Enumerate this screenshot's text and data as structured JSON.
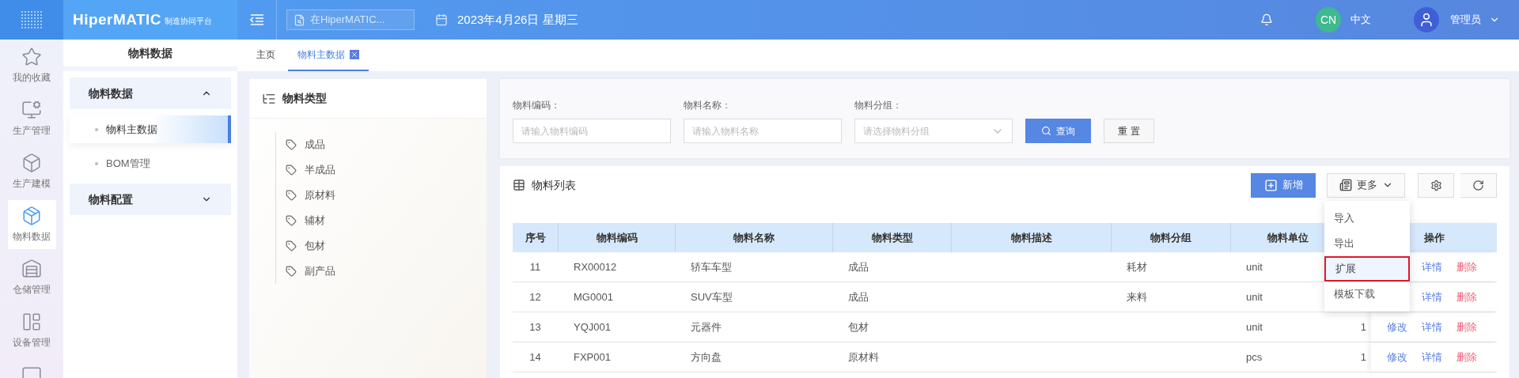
{
  "topbar": {
    "brand": "HiperMATIC",
    "brand_subtitle": "制造协同平台",
    "search": {
      "placeholder": "在HiperMATIC..."
    },
    "date": "2023年4月26日 星期三",
    "language_badge": "CN",
    "language": "中文",
    "user": "管理员"
  },
  "rail": [
    {
      "label": "我的收藏",
      "selected": false
    },
    {
      "label": "生产管理",
      "selected": false
    },
    {
      "label": "生产建模",
      "selected": false
    },
    {
      "label": "物料数据",
      "selected": true
    },
    {
      "label": "仓储管理",
      "selected": false
    },
    {
      "label": "设备管理",
      "selected": false
    }
  ],
  "menu": {
    "title": "物料数据",
    "groups": [
      {
        "label": "物料数据",
        "expanded": true,
        "children": [
          {
            "label": "物料主数据",
            "selected": true
          },
          {
            "label": "BOM管理",
            "selected": false
          }
        ]
      },
      {
        "label": "物料配置",
        "expanded": false
      }
    ]
  },
  "tabs": [
    {
      "label": "主页",
      "selected": false,
      "closable": false
    },
    {
      "label": "物料主数据",
      "selected": true,
      "closable": true
    }
  ],
  "types_panel": {
    "title": "物料类型",
    "items": [
      "成品",
      "半成品",
      "原材料",
      "辅材",
      "包材",
      "副产品"
    ]
  },
  "filters": {
    "fields": [
      {
        "label": "物料编码：",
        "placeholder": "请输入物料编码",
        "kind": "input"
      },
      {
        "label": "物料名称：",
        "placeholder": "请输入物料名称",
        "kind": "input"
      },
      {
        "label": "物料分组：",
        "placeholder": "请选择物料分组",
        "kind": "select"
      }
    ],
    "buttons": [
      {
        "label": "查询",
        "kind": "primary"
      },
      {
        "label": "重 置",
        "kind": "default"
      }
    ]
  },
  "list": {
    "title": "物料列表",
    "add_button": "新增",
    "more_button": "更多",
    "more_menu": [
      {
        "label": "导入",
        "highlighted": false
      },
      {
        "label": "导出",
        "highlighted": false
      },
      {
        "label": "扩展",
        "highlighted": true
      },
      {
        "label": "模板下载",
        "highlighted": false
      }
    ],
    "columns": [
      "序号",
      "物料编码",
      "物料名称",
      "物料类型",
      "物料描述",
      "物料分组",
      "物料单位",
      "操作"
    ],
    "rows": [
      {
        "no": "11",
        "code": "RX00012",
        "name": "轿车车型",
        "type": "成品",
        "group": "耗材",
        "unit": "unit",
        "actions": [
          {
            "kind": "detail",
            "label": "详情"
          },
          {
            "kind": "delete",
            "label": "删除"
          }
        ]
      },
      {
        "no": "12",
        "code": "MG0001",
        "name": "SUV车型",
        "type": "成品",
        "group": "来料",
        "unit": "unit",
        "actions": [
          {
            "kind": "detail",
            "label": "详情"
          },
          {
            "kind": "delete",
            "label": "删除"
          }
        ]
      },
      {
        "no": "13",
        "code": "YQJ001",
        "name": "元器件",
        "type": "包材",
        "unit": "unit",
        "column_8": "1",
        "actions": [
          {
            "kind": "edit",
            "label": "修改"
          },
          {
            "kind": "detail",
            "label": "详情"
          },
          {
            "kind": "delete",
            "label": "删除"
          }
        ]
      },
      {
        "no": "14",
        "code": "FXP001",
        "name": "方向盘",
        "type": "原材料",
        "unit": "pcs",
        "column_8": "1",
        "actions": [
          {
            "kind": "edit",
            "label": "修改"
          },
          {
            "kind": "detail",
            "label": "详情"
          },
          {
            "kind": "delete",
            "label": "删除"
          }
        ]
      }
    ]
  }
}
